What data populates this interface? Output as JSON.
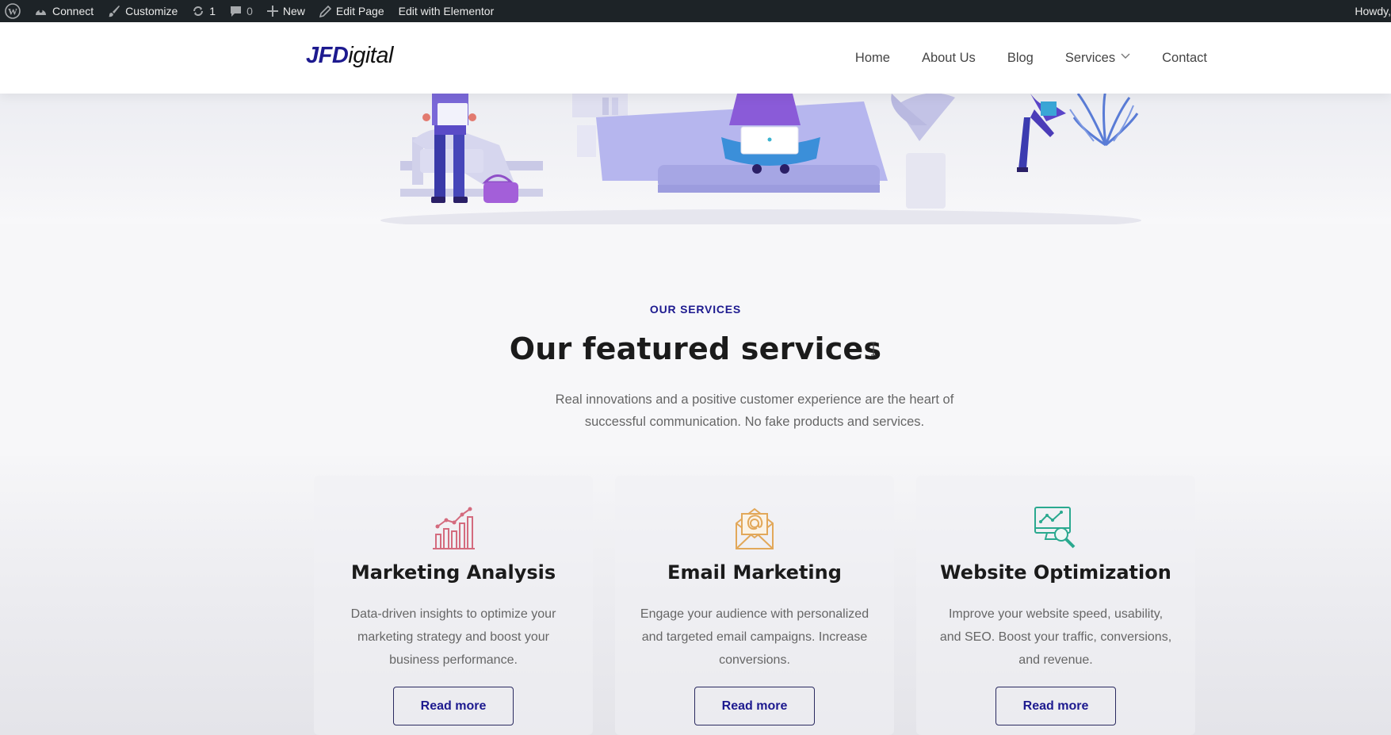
{
  "admin_bar": {
    "items": [
      {
        "label": "Connect",
        "icon": "wpcom-icon"
      },
      {
        "label": "Customize",
        "icon": "brush-icon"
      },
      {
        "label": "1",
        "icon": "updates-icon"
      },
      {
        "label": "0",
        "icon": "comment-icon"
      },
      {
        "label": "New",
        "icon": "plus-icon"
      },
      {
        "label": "Edit Page",
        "icon": "pencil-icon"
      },
      {
        "label": "Edit with Elementor",
        "icon": ""
      }
    ],
    "howdy": "Howdy,"
  },
  "header": {
    "logo_strong": "JFD",
    "logo_light": "igital",
    "nav": [
      "Home",
      "About Us",
      "Blog",
      "Services",
      "Contact"
    ]
  },
  "services": {
    "eyebrow": "OUR SERVICES",
    "title": "Our featured services",
    "description": "Real innovations and a positive customer experience are the heart of successful communication. No fake products and services.",
    "cards": [
      {
        "title": "Marketing Analysis",
        "text": "Data-driven insights to optimize your marketing strategy and boost your business performance.",
        "button": "Read more",
        "icon": "bar-chart-icon",
        "icon_color": "#d46b7e"
      },
      {
        "title": "Email Marketing",
        "text": "Engage your audience with personalized and targeted email campaigns. Increase conversions.",
        "button": "Read more",
        "icon": "envelope-at-icon",
        "icon_color": "#e2a85a"
      },
      {
        "title": "Website Optimization",
        "text": "Improve your website speed, usability, and SEO. Boost your traffic, conversions, and revenue.",
        "button": "Read more",
        "icon": "monitor-search-icon",
        "icon_color": "#2aa98f"
      }
    ]
  },
  "colors": {
    "brand": "#1d1a8f",
    "admin_bar": "#1d2327",
    "hero_purple": "#8a7de8"
  }
}
